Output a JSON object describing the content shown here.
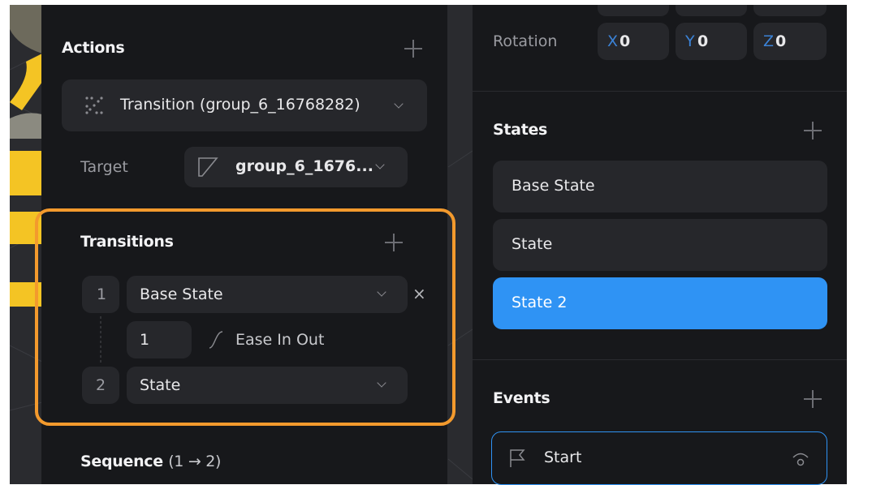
{
  "actions": {
    "title": "Actions",
    "selected_action": "Transition (group_6_16768282)",
    "target_label": "Target",
    "target_value": "group_6_1676..."
  },
  "transitions": {
    "title": "Transitions",
    "rows": [
      {
        "index": "1",
        "state": "Base State"
      },
      {
        "index": "2",
        "state": "State"
      }
    ],
    "duration": "1",
    "easing": "Ease In Out",
    "remove_symbol": "×"
  },
  "sequence": {
    "title": "Sequence",
    "range": "(1 → 2)"
  },
  "rotation": {
    "label": "Rotation",
    "x_axis": "X",
    "x_value": "0",
    "y_axis": "Y",
    "y_value": "0",
    "z_axis": "Z",
    "z_value": "0"
  },
  "states": {
    "title": "States",
    "items": [
      "Base State",
      "State",
      "State 2"
    ],
    "active_index": 2
  },
  "events": {
    "title": "Events",
    "items": [
      "Start"
    ]
  },
  "colors": {
    "accent": "#2f93f4",
    "highlight": "#f39a2d",
    "panel": "#17181b",
    "field": "#26272b"
  },
  "icons": {
    "add": "plus-icon",
    "action": "dotted-transition-icon",
    "target": "layer-shape-icon",
    "dropdown": "chevron-down-icon",
    "easing": "ease-curve-icon",
    "event": "flag-icon",
    "event_settings": "signal-icon"
  }
}
